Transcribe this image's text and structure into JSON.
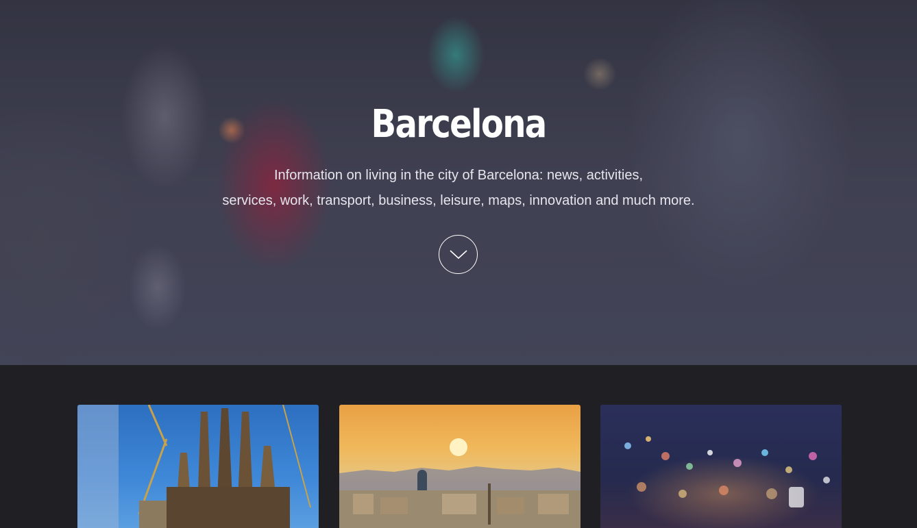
{
  "hero": {
    "title": "Barcelona",
    "subtitle_line1": "Information on living in the city of Barcelona: news, activities,",
    "subtitle_line2": "services, work, transport, business, leisure, maps, innovation and much more.",
    "scroll_icon": "chevron-down-icon"
  },
  "cards": [
    {
      "image": "sagrada-familia-photo"
    },
    {
      "image": "barcelona-skyline-sunset-photo"
    },
    {
      "image": "city-lights-bokeh-photo"
    }
  ],
  "colors": {
    "page_background": "#1f1f24",
    "hero_text": "#ffffff"
  }
}
